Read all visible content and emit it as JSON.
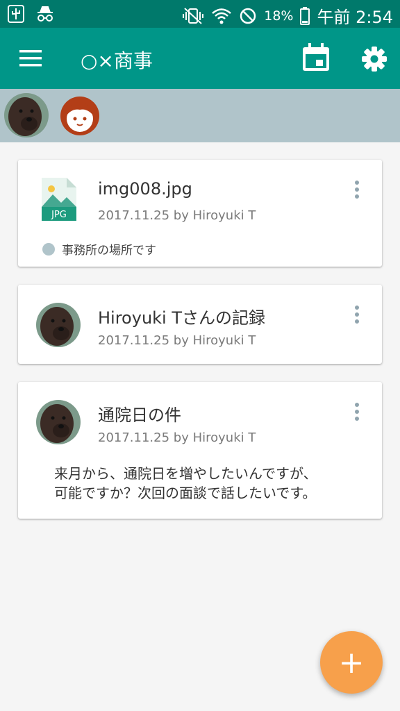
{
  "status_bar": {
    "battery": "18%",
    "time": "午前 2:54",
    "icons": [
      "usb-icon",
      "incognito-icon",
      "vibrate-icon",
      "wifi-icon",
      "block-icon",
      "battery-icon"
    ]
  },
  "app_bar": {
    "title": "○×商事",
    "icons": [
      "menu-icon",
      "calendar-icon",
      "settings-icon"
    ],
    "color": "#009688"
  },
  "members": [
    {
      "avatar": "dog-photo-avatar"
    },
    {
      "avatar": "person-face-avatar"
    }
  ],
  "cards": [
    {
      "type": "file",
      "title": "img008.jpg",
      "meta": "2017.11.25 by Hiroyuki T",
      "thumb_icon": "jpg-file-icon",
      "tag": "事務所の場所です"
    },
    {
      "type": "record",
      "title": "Hiroyuki Tさんの記録",
      "meta": "2017.11.25 by Hiroyuki T",
      "thumb_icon": "dog-photo-avatar"
    },
    {
      "type": "message",
      "title": "通院日の件",
      "meta": "2017.11.25 by Hiroyuki T",
      "thumb_icon": "dog-photo-avatar",
      "body": "来月から、通院日を増やしたいんですが、\n可能ですか？次回の面談で話したいです。"
    }
  ],
  "fab": {
    "label": "+",
    "color": "#f7a04b"
  }
}
